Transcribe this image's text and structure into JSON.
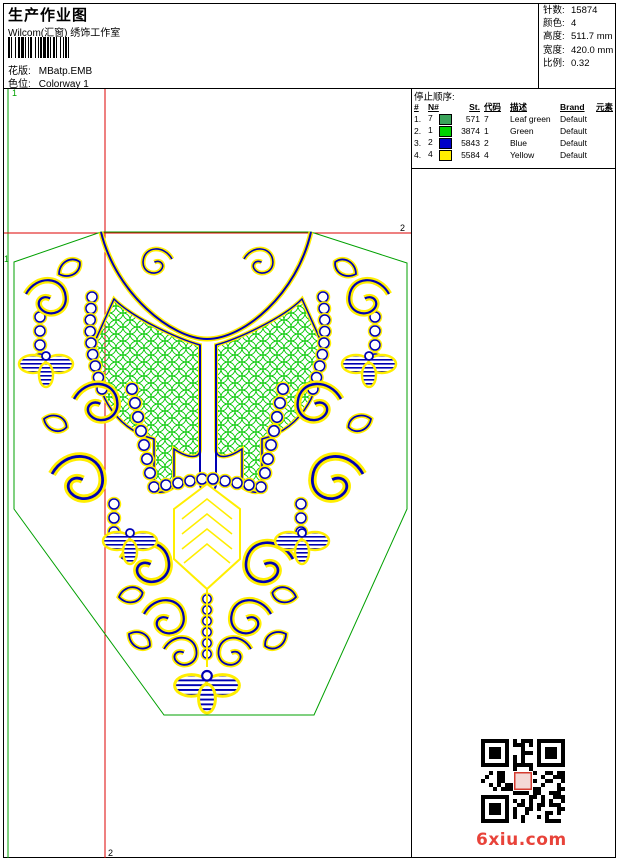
{
  "header": {
    "title": "生产作业图",
    "company": "Wilcom(汇窗) 绣饰工作室",
    "design_label": "花版:",
    "design_value": "MBatp.EMB",
    "colorway_label": "色位:",
    "colorway_value": "Colorway 1"
  },
  "stats": [
    {
      "label": "针数:",
      "value": "15874"
    },
    {
      "label": "颜色:",
      "value": "4"
    },
    {
      "label": "高度:",
      "value": "511.7 mm"
    },
    {
      "label": "宽度:",
      "value": "420.0 mm"
    },
    {
      "label": "比例:",
      "value": "0.32"
    }
  ],
  "stop_sequence": {
    "caption": "停止顺序:",
    "columns": [
      "#",
      "N#",
      "St.",
      "代码",
      "描述",
      "Brand",
      "元素"
    ],
    "rows": [
      {
        "idx": "1.",
        "n": "7",
        "color": "#3aa35a",
        "st": "571",
        "code": "7",
        "desc": "Leaf green",
        "brand": "Default",
        "elem": ""
      },
      {
        "idx": "2.",
        "n": "1",
        "color": "#00d200",
        "st": "3874",
        "code": "1",
        "desc": "Green",
        "brand": "Default",
        "elem": ""
      },
      {
        "idx": "3.",
        "n": "2",
        "color": "#0000c8",
        "st": "5843",
        "code": "2",
        "desc": "Blue",
        "brand": "Default",
        "elem": ""
      },
      {
        "idx": "4.",
        "n": "4",
        "color": "#ffee00",
        "st": "5584",
        "code": "4",
        "desc": "Yellow",
        "brand": "Default",
        "elem": ""
      }
    ]
  },
  "canvas": {
    "marker_1": "1",
    "marker_2": "2",
    "colors": {
      "guide": "#dd0000",
      "outline": "#00a000",
      "blue": "#0000b4",
      "green": "#00dd00",
      "yellow": "#ffee00"
    }
  },
  "watermark": "6xiu.com"
}
